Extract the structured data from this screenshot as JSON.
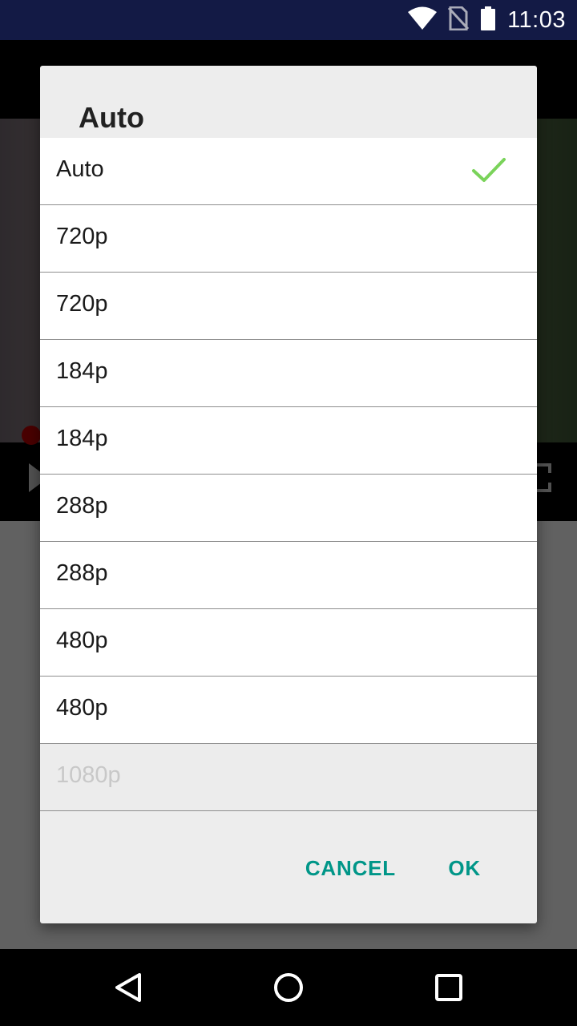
{
  "status_bar": {
    "time": "11:03",
    "icons": [
      "wifi-icon",
      "no-sim-icon",
      "battery-icon"
    ]
  },
  "dialog": {
    "title": "Auto",
    "options": [
      {
        "label": "Auto",
        "selected": true,
        "enabled": true
      },
      {
        "label": "720p",
        "selected": false,
        "enabled": true
      },
      {
        "label": "720p",
        "selected": false,
        "enabled": true
      },
      {
        "label": "184p",
        "selected": false,
        "enabled": true
      },
      {
        "label": "184p",
        "selected": false,
        "enabled": true
      },
      {
        "label": "288p",
        "selected": false,
        "enabled": true
      },
      {
        "label": "288p",
        "selected": false,
        "enabled": true
      },
      {
        "label": "480p",
        "selected": false,
        "enabled": true
      },
      {
        "label": "480p",
        "selected": false,
        "enabled": true
      },
      {
        "label": "1080p",
        "selected": false,
        "enabled": false
      }
    ],
    "cancel_label": "CANCEL",
    "ok_label": "OK"
  },
  "navigation_bar": {
    "icons": [
      "back-icon",
      "home-icon",
      "recents-icon"
    ]
  },
  "colors": {
    "status_bar": "#131a45",
    "accent": "#009688",
    "check": "#7ad35a"
  }
}
